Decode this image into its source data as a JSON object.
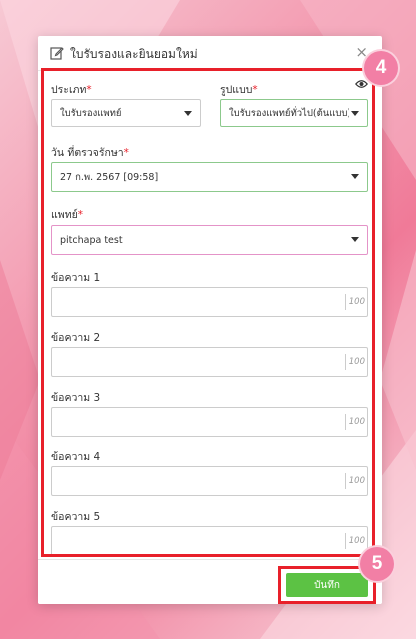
{
  "dialog": {
    "title": "ใบรับรองและยินยอมใหม่",
    "close": "×"
  },
  "form": {
    "type_label": "ประเภท",
    "type_value": "ใบรับรองแพทย์",
    "format_label": "รูปแบบ",
    "format_value": "ใบรับรองแพทย์ทั่วไป(ต้นแบบ)",
    "date_label": "วัน ที่ตรวจรักษา",
    "date_value": "27 ก.พ. 2567 [09:58]",
    "doctor_label": "แพทย์",
    "doctor_value": "pitchapa test",
    "required_mark": "*",
    "messages": [
      {
        "label": "ข้อความ 1",
        "counter": "100"
      },
      {
        "label": "ข้อความ 2",
        "counter": "100"
      },
      {
        "label": "ข้อความ 3",
        "counter": "100"
      },
      {
        "label": "ข้อความ 4",
        "counter": "100"
      },
      {
        "label": "ข้อความ 5",
        "counter": "100"
      }
    ]
  },
  "footer": {
    "save_label": "บันทึก"
  },
  "annotations": {
    "step_form": "4",
    "step_save": "5"
  },
  "colors": {
    "highlight": "#e8202a",
    "save": "#5cc244",
    "badge": "#f27fa5"
  }
}
